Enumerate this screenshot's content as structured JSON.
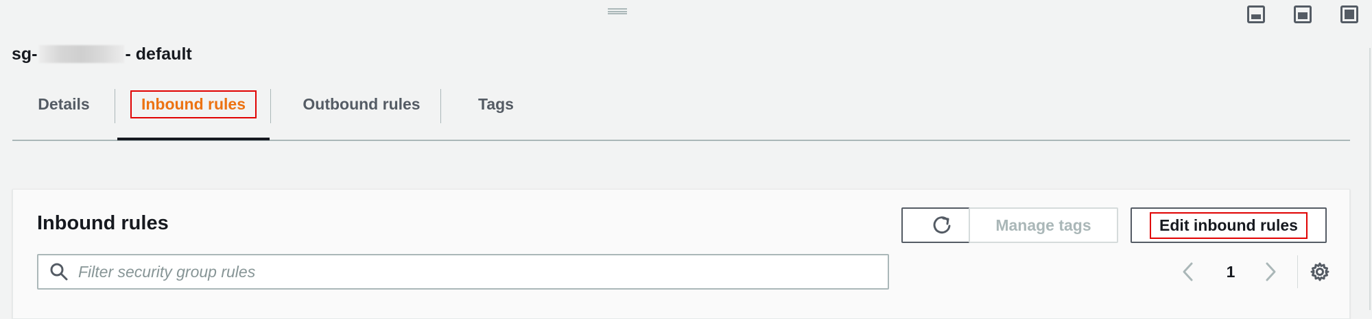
{
  "window": {
    "panel_buttons": [
      "panel-bottom-icon",
      "panel-center-icon",
      "panel-full-icon"
    ]
  },
  "security_group": {
    "prefix": "sg-",
    "suffix": "- default"
  },
  "tabs": [
    {
      "label": "Details",
      "active": false
    },
    {
      "label": "Inbound rules",
      "active": true
    },
    {
      "label": "Outbound rules",
      "active": false
    },
    {
      "label": "Tags",
      "active": false
    }
  ],
  "inbound_panel": {
    "title": "Inbound rules",
    "refresh_icon": "refresh-icon",
    "manage_tags_label": "Manage tags",
    "edit_label": "Edit inbound rules",
    "search": {
      "placeholder": "Filter security group rules",
      "value": ""
    },
    "pagination": {
      "current_page": "1"
    },
    "settings_icon": "gear-icon"
  },
  "colors": {
    "active_tab": "#ec7211",
    "highlight_box": "#e00000",
    "background": "#f2f3f3"
  }
}
